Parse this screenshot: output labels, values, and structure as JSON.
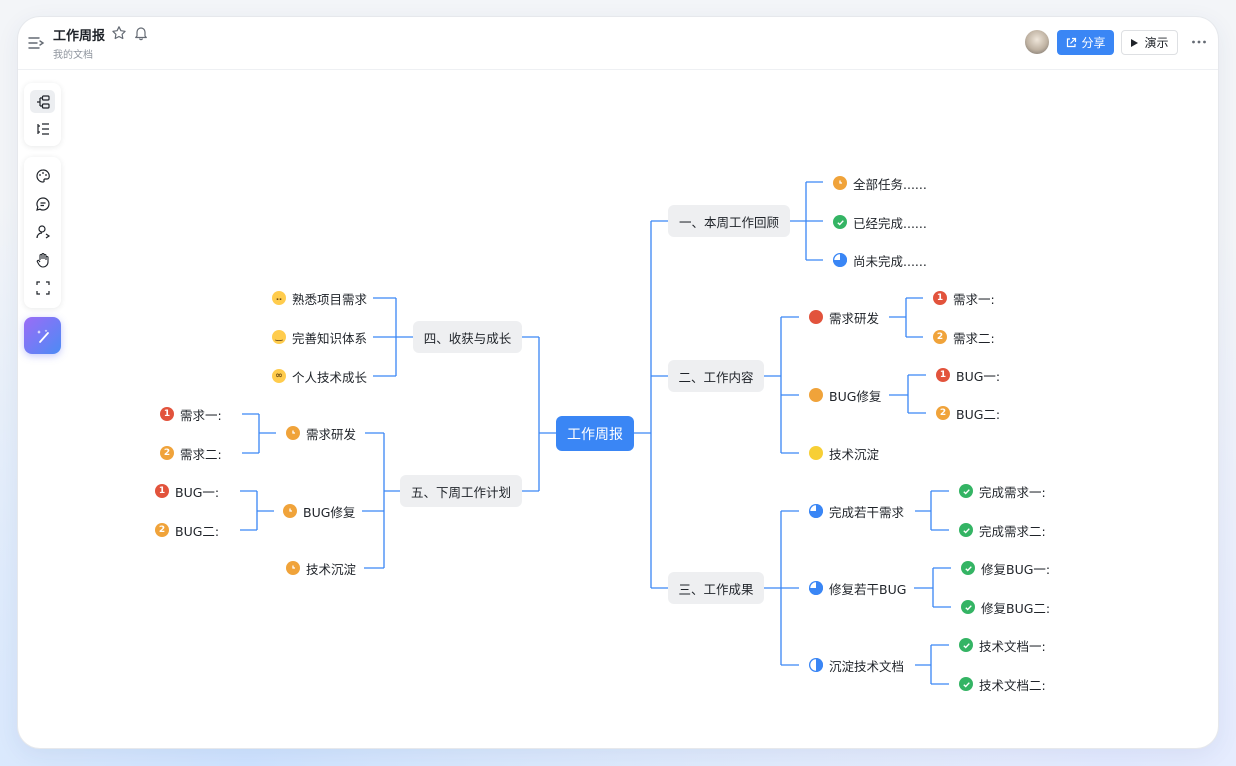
{
  "header": {
    "title": "工作周报",
    "subtitle": "我的文档",
    "share_label": "分享",
    "present_label": "演示"
  },
  "toolbar": {
    "icons": [
      "structure-icon",
      "outline-icon",
      "theme-icon",
      "comment-icon",
      "user-icon",
      "hand-icon",
      "fullscreen-icon",
      "ai-magic-icon"
    ]
  },
  "colors": {
    "accent": "#3a86f5",
    "line": "#3a86f5",
    "branch_bg": "#eeeff1"
  },
  "mindmap": {
    "root": "工作周报",
    "review": {
      "label": "一、本周工作回顾",
      "items": [
        "全部任务......",
        "已经完成......",
        "尚未完成......"
      ]
    },
    "content": {
      "label": "二、工作内容",
      "req": {
        "label": "需求研发",
        "items": [
          "需求一:",
          "需求二:"
        ]
      },
      "bug": {
        "label": "BUG修复",
        "items": [
          "BUG一:",
          "BUG二:"
        ]
      },
      "tech": {
        "label": "技术沉淀"
      }
    },
    "results": {
      "label": "三、工作成果",
      "req": {
        "label": "完成若干需求",
        "items": [
          "完成需求一:",
          "完成需求二:"
        ]
      },
      "bug": {
        "label": "修复若干BUG",
        "items": [
          "修复BUG一:",
          "修复BUG二:"
        ]
      },
      "doc": {
        "label": "沉淀技术文档",
        "items": [
          "技术文档一:",
          "技术文档二:"
        ]
      }
    },
    "growth": {
      "label": "四、收获与成长",
      "items": [
        "熟悉项目需求",
        "完善知识体系",
        "个人技术成长"
      ]
    },
    "plan": {
      "label": "五、下周工作计划",
      "req": {
        "label": "需求研发",
        "items": [
          "需求一:",
          "需求二:"
        ]
      },
      "bug": {
        "label": "BUG修复",
        "items": [
          "BUG一:",
          "BUG二:"
        ]
      },
      "tech": {
        "label": "技术沉淀"
      }
    },
    "badges": [
      "1",
      "2"
    ]
  }
}
